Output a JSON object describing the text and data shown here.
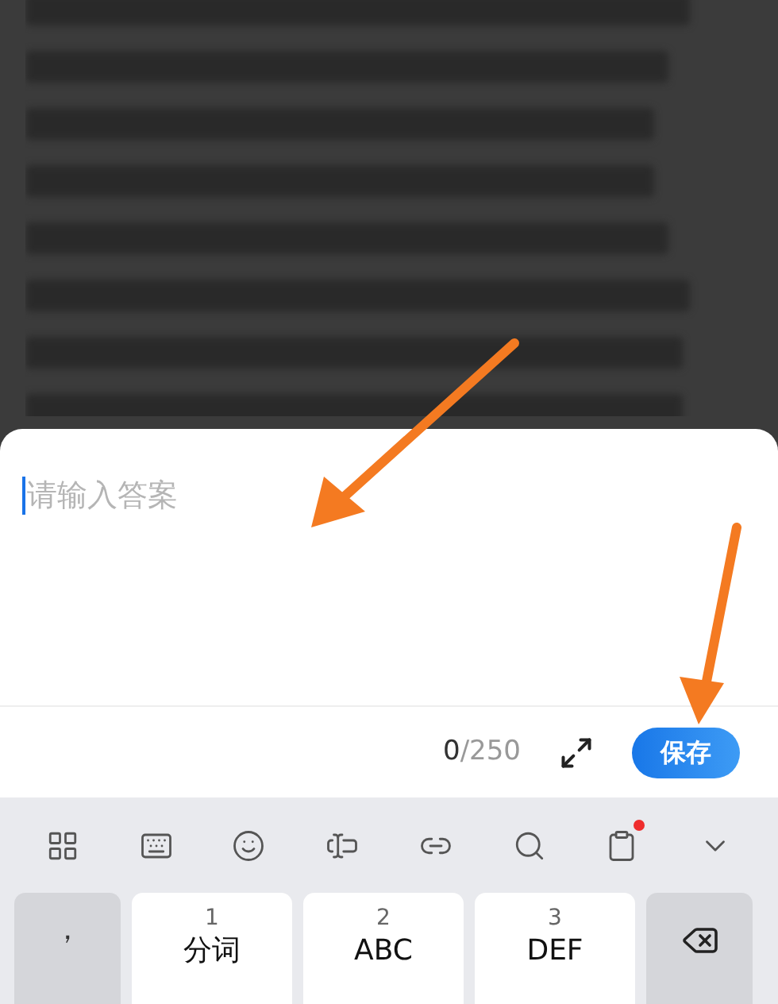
{
  "answer_field": {
    "placeholder": "请输入答案"
  },
  "counter": {
    "count": "0",
    "limit": "/250"
  },
  "save_button": {
    "label": "保存"
  },
  "keyboard_toolbar": [
    {
      "kind": "grid",
      "badge": false
    },
    {
      "kind": "keyboard",
      "badge": false
    },
    {
      "kind": "emoji",
      "badge": false
    },
    {
      "kind": "cursor",
      "badge": false
    },
    {
      "kind": "link",
      "badge": false
    },
    {
      "kind": "search",
      "badge": false
    },
    {
      "kind": "clipboard",
      "badge": true
    },
    {
      "kind": "collapse",
      "badge": false
    }
  ],
  "keys": [
    {
      "kind": "symbol",
      "label": "，"
    },
    {
      "kind": "letter",
      "digit": "1",
      "label": "分词"
    },
    {
      "kind": "letter",
      "digit": "2",
      "label": "ABC"
    },
    {
      "kind": "letter",
      "digit": "3",
      "label": "DEF"
    },
    {
      "kind": "backspace"
    }
  ]
}
